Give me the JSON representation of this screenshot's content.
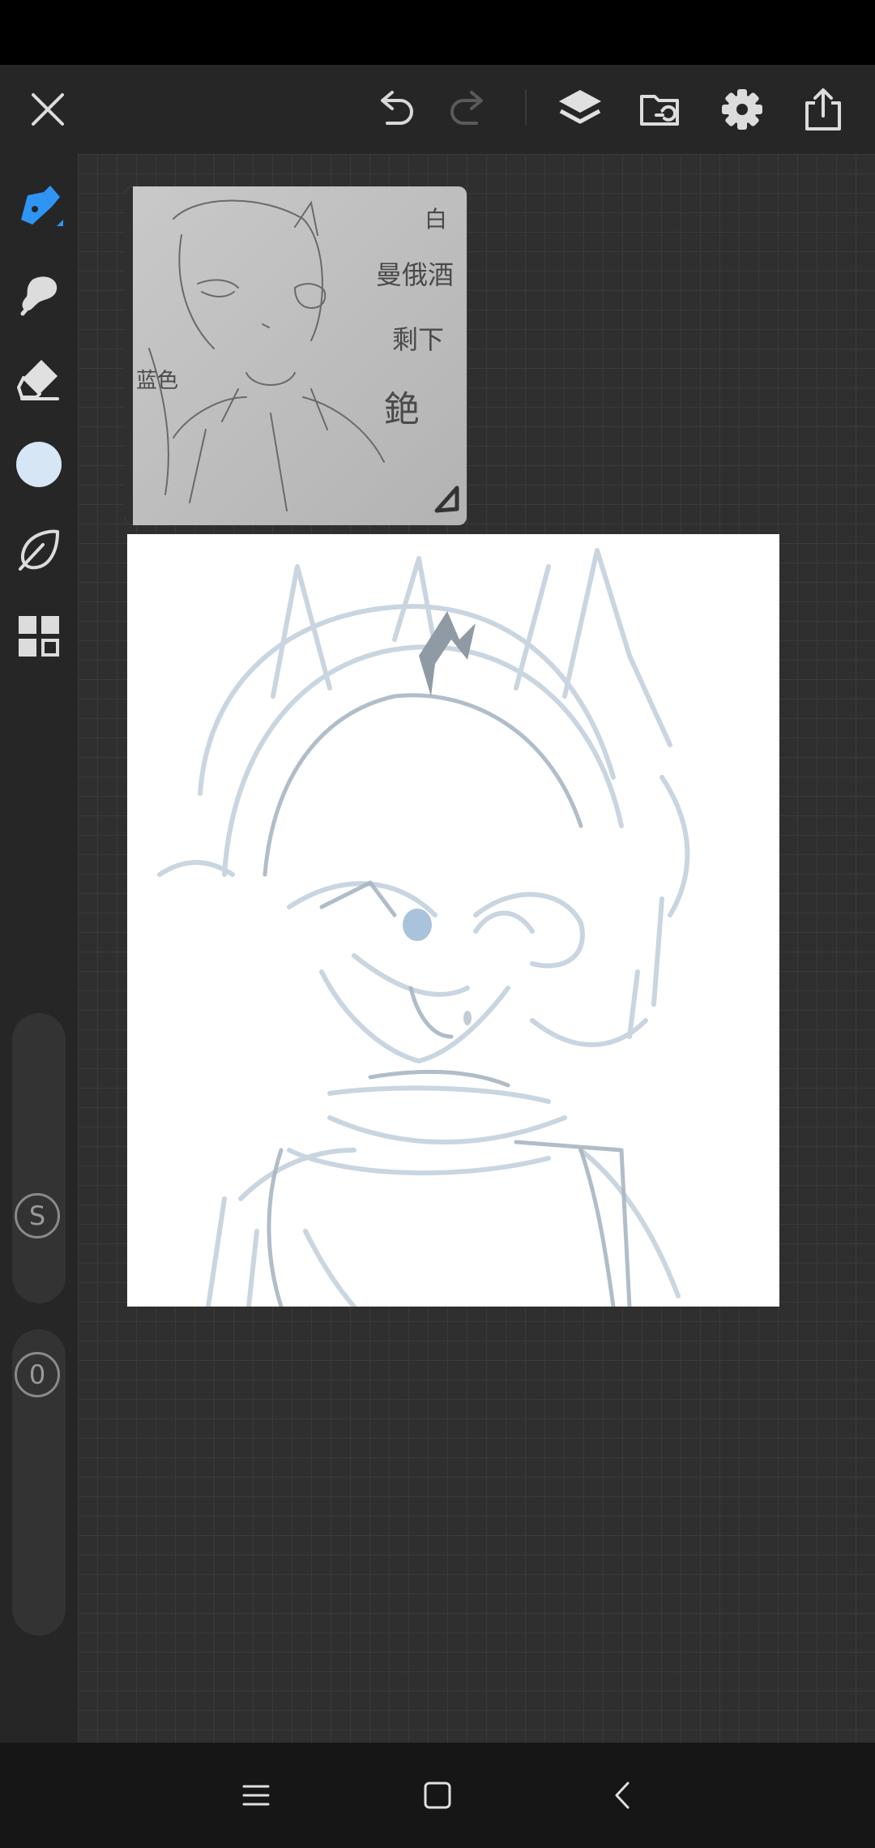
{
  "app": {
    "name": "drawing-app"
  },
  "colors": {
    "accent": "#2f95f5",
    "current_color": "#d6e6f5",
    "sketch": "#b7c6d4",
    "icon": "#d8d8d8"
  },
  "toolbar": {
    "icons": [
      "close-icon",
      "undo-icon",
      "redo-icon",
      "layers-icon",
      "gallery-icon",
      "settings-icon",
      "share-icon"
    ]
  },
  "side_toolbar": {
    "tools": [
      "brush-tool-icon",
      "smudge-tool-icon",
      "eraser-tool-icon",
      "color-swatch",
      "lasso-tool-icon",
      "layout-icon"
    ],
    "size_slider": {
      "label": "S"
    },
    "opacity_slider": {
      "label": "0"
    }
  },
  "canvas": {
    "reference_text": [
      "白",
      "曼俄酒",
      "剩下",
      "銫",
      "蓝色"
    ]
  },
  "nav_bar": {
    "icons": [
      "recent-apps-icon",
      "home-icon",
      "back-icon"
    ]
  }
}
